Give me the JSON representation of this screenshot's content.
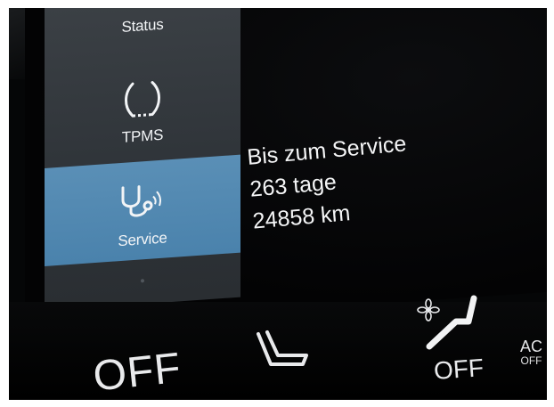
{
  "sidebar": {
    "items": [
      {
        "label": "Status"
      },
      {
        "label": "TPMS"
      },
      {
        "label": "Service"
      }
    ]
  },
  "info": {
    "line1": "Bis zum Service",
    "line2": "263 tage",
    "line3": "24858 km"
  },
  "climate": {
    "left_label": "OFF",
    "right_label": "OFF",
    "ac_label": "AC",
    "ac_sub": "OFF"
  }
}
